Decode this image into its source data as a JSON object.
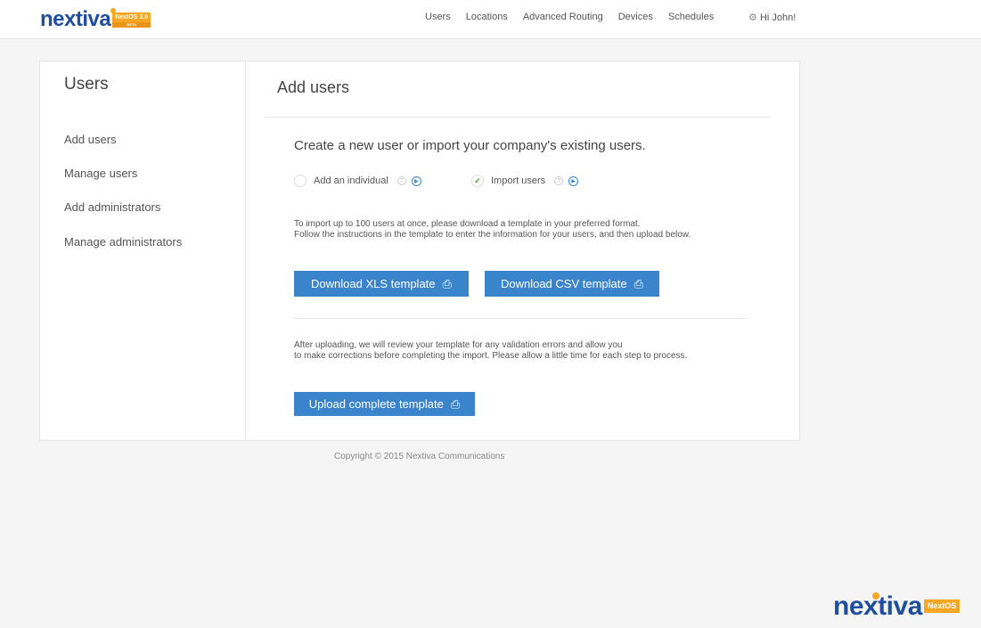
{
  "header": {
    "logo_text": "nextiva",
    "logo_badge": "NextOS 3.0",
    "logo_badge_sub": "BETA",
    "nav": [
      "Users",
      "Locations",
      "Advanced Routing",
      "Devices",
      "Schedules"
    ],
    "greeting": "Hi John!"
  },
  "sidebar": {
    "title": "Users",
    "items": [
      {
        "label": "Add users"
      },
      {
        "label": "Manage users"
      },
      {
        "label": "Add administrators"
      },
      {
        "label": "Manage administrators"
      }
    ]
  },
  "main": {
    "title": "Add users",
    "subtitle": "Create a new user or import your company's existing users.",
    "options": [
      {
        "label": "Add an individual",
        "selected": false
      },
      {
        "label": "Import users",
        "selected": true
      }
    ],
    "instructions": [
      "To import up to 100 users at once, please download a template in your preferred format.",
      "Follow the instructions in the template to enter the information for your users, and then upload below."
    ],
    "download_xls": "Download XLS template",
    "download_csv": "Download CSV template",
    "after": [
      "After uploading, we will review your template for any validation errors and allow you",
      "to make corrections before completing the import. Please allow a little time for each step to process."
    ],
    "upload": "Upload complete template"
  },
  "footer": {
    "copyright": "Copyright © 2015 Nextiva Communications",
    "logo_text": "nextiva",
    "logo_badge": "NextOS"
  },
  "colors": {
    "accent": "#3a84cc",
    "brand": "#1f4e9c",
    "brand_orange": "#f5a623"
  }
}
